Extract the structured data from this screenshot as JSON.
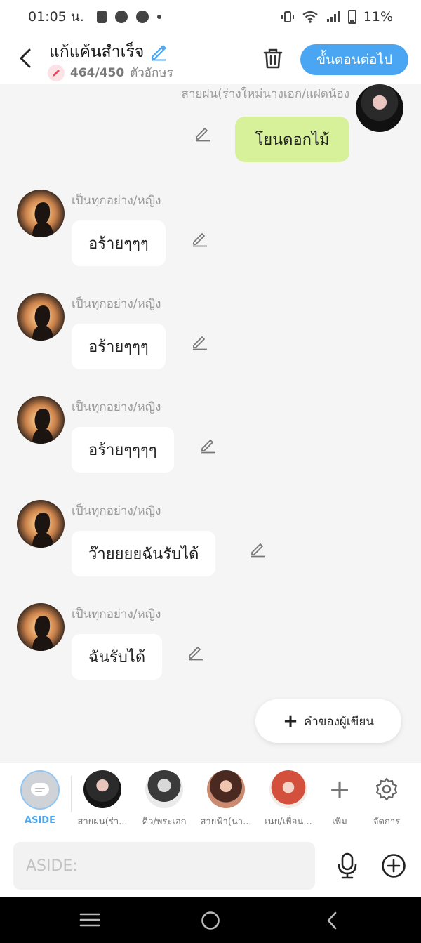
{
  "status": {
    "time": "01:05 น.",
    "battery": "11%"
  },
  "header": {
    "title": "แก้แค้นสำเร็จ",
    "count": "464/450",
    "count_unit": "ตัวอักษร",
    "next_label": "ขั้นตอนต่อไป"
  },
  "chat": {
    "right": {
      "name": "สายฝน(ร่างใหม่นางเอก/แฝดน้อง",
      "text": "โยนดอกไม้"
    },
    "messages": [
      {
        "name": "เป็นทุกอย่าง/หญิง",
        "text": "อร้ายๆๆๆ"
      },
      {
        "name": "เป็นทุกอย่าง/หญิง",
        "text": "อร้ายๆๆๆ"
      },
      {
        "name": "เป็นทุกอย่าง/หญิง",
        "text": "อร้ายๆๆๆๆ"
      },
      {
        "name": "เป็นทุกอย่าง/หญิง",
        "text": "ว๊ายยยยฉันรับได้"
      },
      {
        "name": "เป็นทุกอย่าง/หญิง",
        "text": "ฉันรับได้"
      }
    ],
    "author_label": "คำของผู้เขียน"
  },
  "characters": {
    "aside": "ASIDE",
    "items": [
      "สายฝน(ร่า...",
      "คิว/พระเอก",
      "สายฟ้า(นา...",
      "เนย/เพื่อน..."
    ],
    "add": "เพิ่ม",
    "manage": "จัดการ"
  },
  "input": {
    "placeholder": "ASIDE:"
  },
  "colors": {
    "accent": "#4aa6f2",
    "bubble_right": "#d7f09a"
  }
}
